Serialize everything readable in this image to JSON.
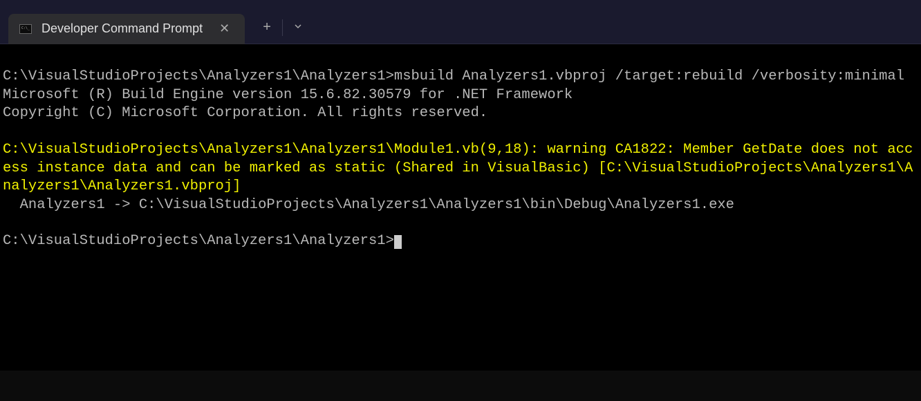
{
  "tab": {
    "title": "Developer Command Prompt"
  },
  "terminal": {
    "line1_prompt": "C:\\VisualStudioProjects\\Analyzers1\\Analyzers1>",
    "line1_cmd": "msbuild Analyzers1.vbproj /target:rebuild /verbosity:minimal",
    "line2": "Microsoft (R) Build Engine version 15.6.82.30579 for .NET Framework",
    "line3": "Copyright (C) Microsoft Corporation. All rights reserved.",
    "warning": "C:\\VisualStudioProjects\\Analyzers1\\Analyzers1\\Module1.vb(9,18): warning CA1822: Member GetDate does not access instance data and can be marked as static (Shared in VisualBasic) [C:\\VisualStudioProjects\\Analyzers1\\Analyzers1\\Analyzers1.vbproj]",
    "output": "  Analyzers1 -> C:\\VisualStudioProjects\\Analyzers1\\Analyzers1\\bin\\Debug\\Analyzers1.exe",
    "final_prompt": "C:\\VisualStudioProjects\\Analyzers1\\Analyzers1>"
  }
}
